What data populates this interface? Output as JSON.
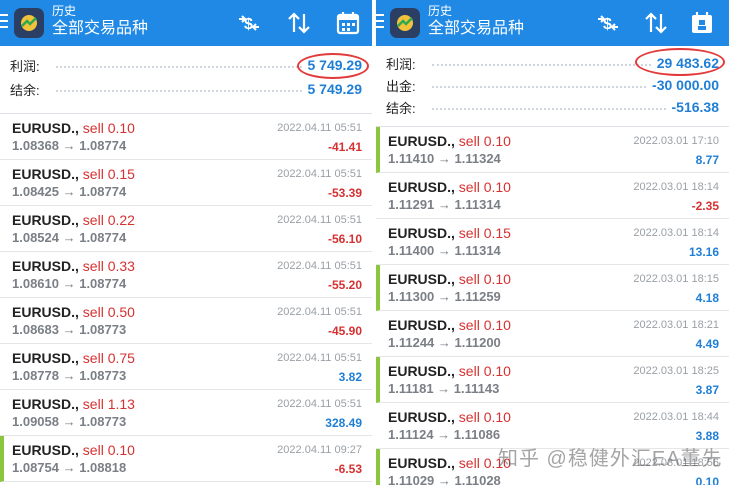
{
  "left": {
    "header": {
      "subtitle": "历史",
      "title": "全部交易品种"
    },
    "summary": [
      {
        "label": "利润:",
        "value": "5 749.29"
      },
      {
        "label": "结余:",
        "value": "5 749.29"
      }
    ],
    "deals": [
      {
        "symbol": "EURUSD.,",
        "side": "sell 0.10",
        "prices": "1.08368 → 1.08774",
        "time": "2022.04.11 05:51",
        "profit": "-41.41",
        "sign": "neg",
        "marked": false
      },
      {
        "symbol": "EURUSD.,",
        "side": "sell 0.15",
        "prices": "1.08425 → 1.08774",
        "time": "2022.04.11 05:51",
        "profit": "-53.39",
        "sign": "neg",
        "marked": false
      },
      {
        "symbol": "EURUSD.,",
        "side": "sell 0.22",
        "prices": "1.08524 → 1.08774",
        "time": "2022.04.11 05:51",
        "profit": "-56.10",
        "sign": "neg",
        "marked": false
      },
      {
        "symbol": "EURUSD.,",
        "side": "sell 0.33",
        "prices": "1.08610 → 1.08774",
        "time": "2022.04.11 05:51",
        "profit": "-55.20",
        "sign": "neg",
        "marked": false
      },
      {
        "symbol": "EURUSD.,",
        "side": "sell 0.50",
        "prices": "1.08683 → 1.08773",
        "time": "2022.04.11 05:51",
        "profit": "-45.90",
        "sign": "neg",
        "marked": false
      },
      {
        "symbol": "EURUSD.,",
        "side": "sell 0.75",
        "prices": "1.08778 → 1.08773",
        "time": "2022.04.11 05:51",
        "profit": "3.82",
        "sign": "pos",
        "marked": false
      },
      {
        "symbol": "EURUSD.,",
        "side": "sell 1.13",
        "prices": "1.09058 → 1.08773",
        "time": "2022.04.11 05:51",
        "profit": "328.49",
        "sign": "pos",
        "marked": false
      },
      {
        "symbol": "EURUSD.,",
        "side": "sell 0.10",
        "prices": "1.08754 → 1.08818",
        "time": "2022.04.11 09:27",
        "profit": "-6.53",
        "sign": "neg",
        "marked": true
      }
    ]
  },
  "right": {
    "header": {
      "subtitle": "历史",
      "title": "全部交易品种"
    },
    "summary": [
      {
        "label": "利润:",
        "value": "29 483.62"
      },
      {
        "label": "出金:",
        "value": "-30 000.00"
      },
      {
        "label": "结余:",
        "value": "-516.38"
      }
    ],
    "deals": [
      {
        "symbol": "EURUSD.,",
        "side": "sell 0.10",
        "prices": "1.11410 → 1.11324",
        "time": "2022.03.01 17:10",
        "profit": "8.77",
        "sign": "pos",
        "marked": true
      },
      {
        "symbol": "EURUSD.,",
        "side": "sell 0.10",
        "prices": "1.11291 → 1.11314",
        "time": "2022.03.01 18:14",
        "profit": "-2.35",
        "sign": "neg",
        "marked": false
      },
      {
        "symbol": "EURUSD.,",
        "side": "sell 0.15",
        "prices": "1.11400 → 1.11314",
        "time": "2022.03.01 18:14",
        "profit": "13.16",
        "sign": "pos",
        "marked": false
      },
      {
        "symbol": "EURUSD.,",
        "side": "sell 0.10",
        "prices": "1.11300 → 1.11259",
        "time": "2022.03.01 18:15",
        "profit": "4.18",
        "sign": "pos",
        "marked": true
      },
      {
        "symbol": "EURUSD.,",
        "side": "sell 0.10",
        "prices": "1.11244 → 1.11200",
        "time": "2022.03.01 18:21",
        "profit": "4.49",
        "sign": "pos",
        "marked": false
      },
      {
        "symbol": "EURUSD.,",
        "side": "sell 0.10",
        "prices": "1.11181 → 1.11143",
        "time": "2022.03.01 18:25",
        "profit": "3.87",
        "sign": "pos",
        "marked": true
      },
      {
        "symbol": "EURUSD.,",
        "side": "sell 0.10",
        "prices": "1.11124 → 1.11086",
        "time": "2022.03.01 18:44",
        "profit": "3.88",
        "sign": "pos",
        "marked": false
      },
      {
        "symbol": "EURUSD.,",
        "side": "sell 0.10",
        "prices": "1.11029 → 1.11028",
        "time": "2022.03.01 18:56",
        "profit": "0.10",
        "sign": "pos",
        "marked": true
      }
    ]
  },
  "watermark": "知乎 @稳健外汇EA董先",
  "colors": {
    "appbar": "#1f89e5",
    "profit_positive": "#1f7fd6",
    "profit_negative": "#d63131",
    "marker": "#8cc63f",
    "annotation": "#e23a3a"
  },
  "icons": [
    "menu-icon",
    "app-logo-icon",
    "currency-exchange-icon",
    "sort-icon",
    "calendar-icon"
  ]
}
